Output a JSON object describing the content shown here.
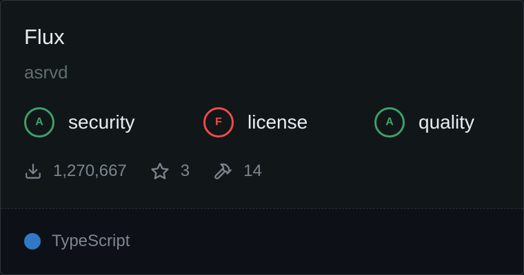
{
  "package": {
    "name": "Flux",
    "author": "asrvd"
  },
  "scores": [
    {
      "grade": "A",
      "label": "security",
      "status": "good",
      "color": "#3fa06a"
    },
    {
      "grade": "F",
      "label": "license",
      "status": "bad",
      "color": "#f04b4b"
    },
    {
      "grade": "A",
      "label": "quality",
      "status": "good",
      "color": "#3fa06a"
    }
  ],
  "stats": {
    "downloads": "1,270,667",
    "downloads_icon": "download-icon",
    "stars": "3",
    "stars_icon": "star-icon",
    "dependents": "14",
    "dependents_icon": "hammer-icon"
  },
  "language": {
    "name": "TypeScript",
    "color": "#3178c6"
  },
  "theme": {
    "background": "#0d1117",
    "text_primary": "#e6edf3",
    "text_muted": "#7d8590"
  }
}
